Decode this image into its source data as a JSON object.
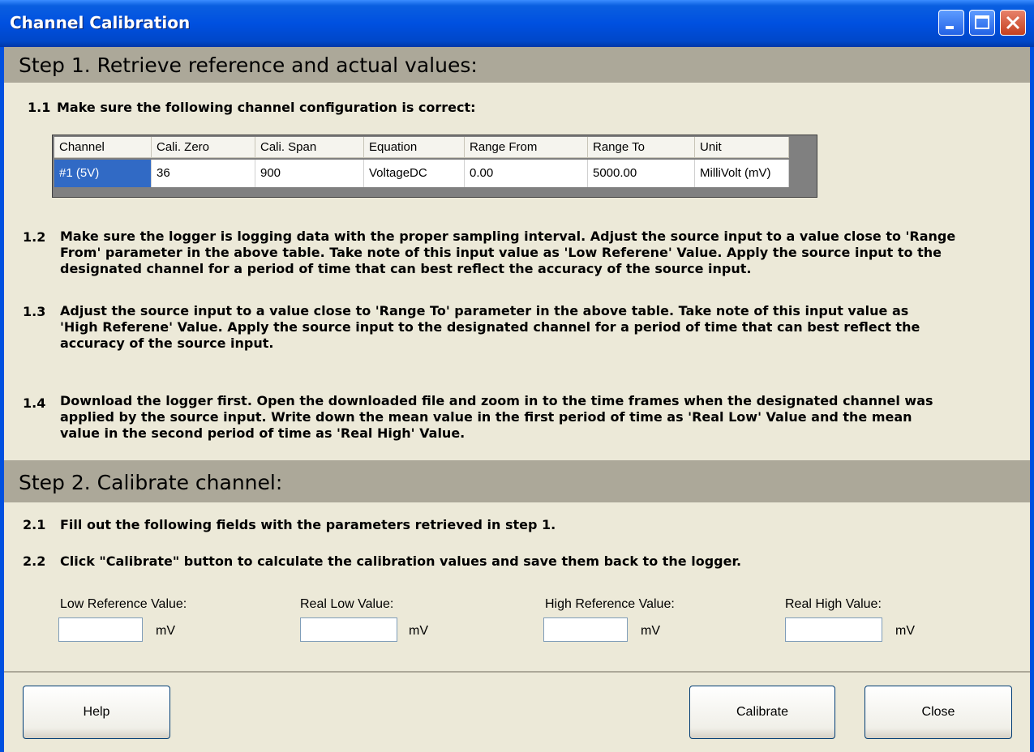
{
  "window": {
    "title": "Channel Calibration"
  },
  "step1": {
    "heading": "Step 1. Retrieve reference and actual values:",
    "s1_1": {
      "num": "1.1",
      "text": "Make sure the following channel configuration is correct:"
    },
    "table": {
      "columns": [
        "Channel",
        "Cali. Zero",
        "Cali. Span",
        "Equation",
        "Range From",
        "Range To",
        "Unit"
      ],
      "row": [
        "#1 (5V)",
        "36",
        "900",
        "VoltageDC",
        "0.00",
        "5000.00",
        "MilliVolt (mV)"
      ]
    },
    "s1_2": {
      "num": "1.2",
      "lines": [
        "Make sure the logger is logging data with the proper sampling interval. Adjust the source input to a value close to 'Range",
        "From' parameter in the above table.  Take note of this input value as 'Low Referene' Value. Apply the source input to the",
        "designated channel for a period of time that can best reflect the accuracy of the source input."
      ]
    },
    "s1_3": {
      "num": "1.3",
      "lines": [
        "Adjust the source input to a value close to 'Range To' parameter in the above table. Take note of this input value as",
        "'High Referene' Value. Apply the source input to the designated channel for a period of time that can best reflect the",
        "accuracy of the source input."
      ]
    },
    "s1_4": {
      "num": "1.4",
      "lines": [
        "Download the logger first. Open the downloaded file and zoom in to the time frames when the designated channel was",
        "applied by the source input. Write down the mean value in the first period of time as 'Real Low' Value and the mean",
        "value in the second period of time as 'Real High' Value."
      ]
    }
  },
  "step2": {
    "heading": "Step 2. Calibrate channel:",
    "s2_1": {
      "num": "2.1",
      "text": "Fill out the following fields with the parameters retrieved in step 1."
    },
    "s2_2": {
      "num": "2.2",
      "text": "Click \"Calibrate\" button to calculate the calibration values and save them back to the logger."
    },
    "fields": [
      {
        "label": "Low Reference Value:",
        "value": "",
        "unit": "mV"
      },
      {
        "label": "Real Low Value:",
        "value": "",
        "unit": "mV"
      },
      {
        "label": "High Reference Value:",
        "value": "",
        "unit": "mV"
      },
      {
        "label": "Real High Value:",
        "value": "",
        "unit": "mV"
      }
    ]
  },
  "buttons": {
    "help": "Help",
    "calibrate": "Calibrate",
    "close": "Close"
  }
}
